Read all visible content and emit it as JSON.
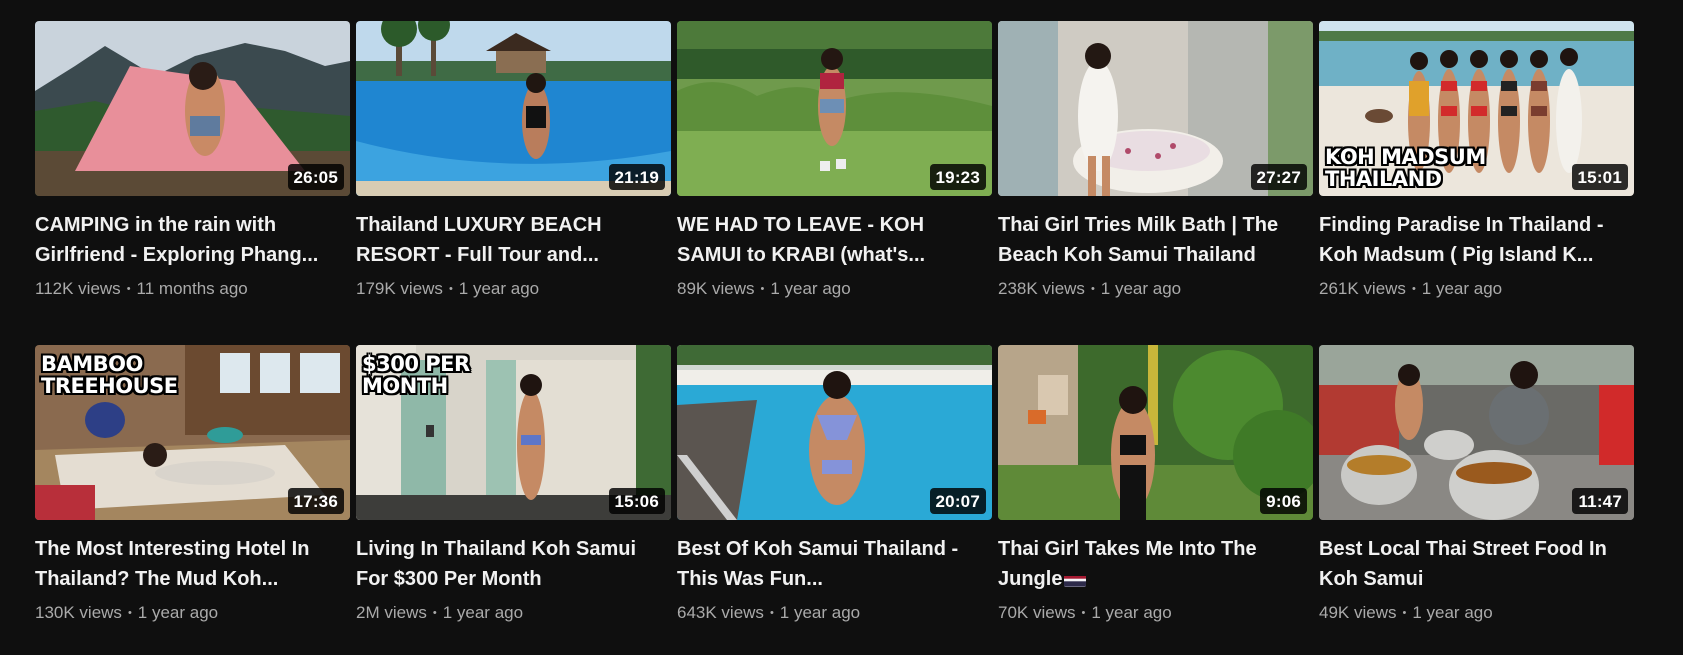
{
  "colors": {
    "background": "#0f0f0f",
    "title": "#f1f1f1",
    "meta": "#aaaaaa"
  },
  "videos": [
    {
      "title": "CAMPING in the rain with Girlfriend - Exploring Phang...",
      "duration": "26:05",
      "views": "112K views",
      "age": "11 months ago",
      "overlay": "",
      "scene": "mountain-camping"
    },
    {
      "title": "Thailand LUXURY BEACH RESORT - Full Tour and...",
      "duration": "21:19",
      "views": "179K views",
      "age": "1 year ago",
      "overlay": "",
      "scene": "pool-resort"
    },
    {
      "title": "WE HAD TO LEAVE - KOH SAMUI to KRABI (what's...",
      "duration": "19:23",
      "views": "89K views",
      "age": "1 year ago",
      "overlay": "",
      "scene": "garden-lawn"
    },
    {
      "title": "Thai Girl Tries Milk Bath | The Beach Koh Samui Thailand",
      "duration": "27:27",
      "views": "238K views",
      "age": "1 year ago",
      "overlay": "",
      "scene": "bathroom"
    },
    {
      "title": "Finding Paradise In Thailand - Koh Madsum ( Pig Island K...",
      "duration": "15:01",
      "views": "261K views",
      "age": "1 year ago",
      "overlay": "KOH MADSUM\nTHAILAND",
      "scene": "beach-group"
    },
    {
      "title": "The Most Interesting Hotel In Thailand? The Mud Koh...",
      "duration": "17:36",
      "views": "130K views",
      "age": "1 year ago",
      "overlay": "BAMBOO\nTREEHOUSE",
      "scene": "treehouse"
    },
    {
      "title": "Living In Thailand Koh Samui For $300 Per Month",
      "duration": "15:06",
      "views": "2M views",
      "age": "1 year ago",
      "overlay": "$300 PER\nMONTH",
      "scene": "shower"
    },
    {
      "title": "Best Of Koh Samui Thailand - This Was Fun...",
      "duration": "20:07",
      "views": "643K views",
      "age": "1 year ago",
      "overlay": "",
      "scene": "pool-ladder"
    },
    {
      "title": "Thai Girl Takes Me Into The Jungle",
      "duration": "9:06",
      "views": "70K views",
      "age": "1 year ago",
      "overlay": "",
      "scene": "jungle",
      "flag": "thailand-flag-icon"
    },
    {
      "title": "Best Local Thai Street Food In Koh Samui",
      "duration": "11:47",
      "views": "49K views",
      "age": "1 year ago",
      "overlay": "",
      "scene": "street-food"
    }
  ]
}
